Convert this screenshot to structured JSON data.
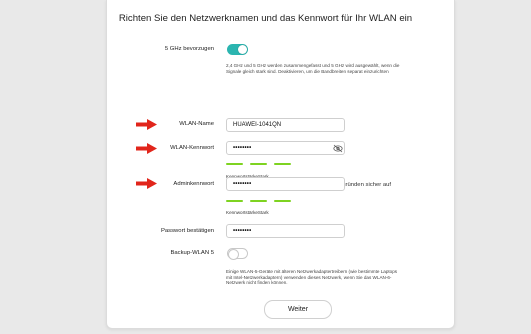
{
  "page": {
    "title": "Richten Sie den Netzwerknamen und das Kennwort für Ihr WLAN ein"
  },
  "prefer_5ghz": {
    "label": "5 GHz bevorzugen",
    "enabled": true,
    "note": "2,4 GHz und 5 GHz werden zusammengefasst und 5 GHz wird ausgewählt, wenn die Signale gleich stark sind. Deaktivieren, um die Bandbreiten separat einzurichten"
  },
  "wlan_name": {
    "label": "WLAN-Name",
    "value": "HUAWEI-1041QN"
  },
  "wlan_password": {
    "label": "WLAN-Kennwort",
    "value": "••••••••",
    "strength_label": "KennwortstärkeStark",
    "hint": "Bewahren Sie das Kennwort aus Sicherheitsgründen sicher auf"
  },
  "admin_password": {
    "label": "Adminkennwort",
    "value": "••••••••",
    "strength_label": "KennwortstärkeStark"
  },
  "confirm_password": {
    "label": "Passwort bestätigen",
    "value": "••••••••"
  },
  "backup_wlan5": {
    "label": "Backup-WLAN 5",
    "enabled": false,
    "note": "Einige WLAN-5-Geräte mit älteren Netzwerkadaptertreibern (wie bestimmte Laptops mit Intel-Netzwerkadaptern) verwenden dieses Netzwerk, wenn Sie das WLAN-6-Netzwerk nicht finden können."
  },
  "next_button": {
    "label": "Weiter"
  },
  "colors": {
    "accent": "#2bb5b0",
    "strength": "#7ed321",
    "arrow": "#e1251b"
  },
  "icons": {
    "arrow": "right-arrow-icon",
    "eye": "eye-hidden-icon"
  }
}
